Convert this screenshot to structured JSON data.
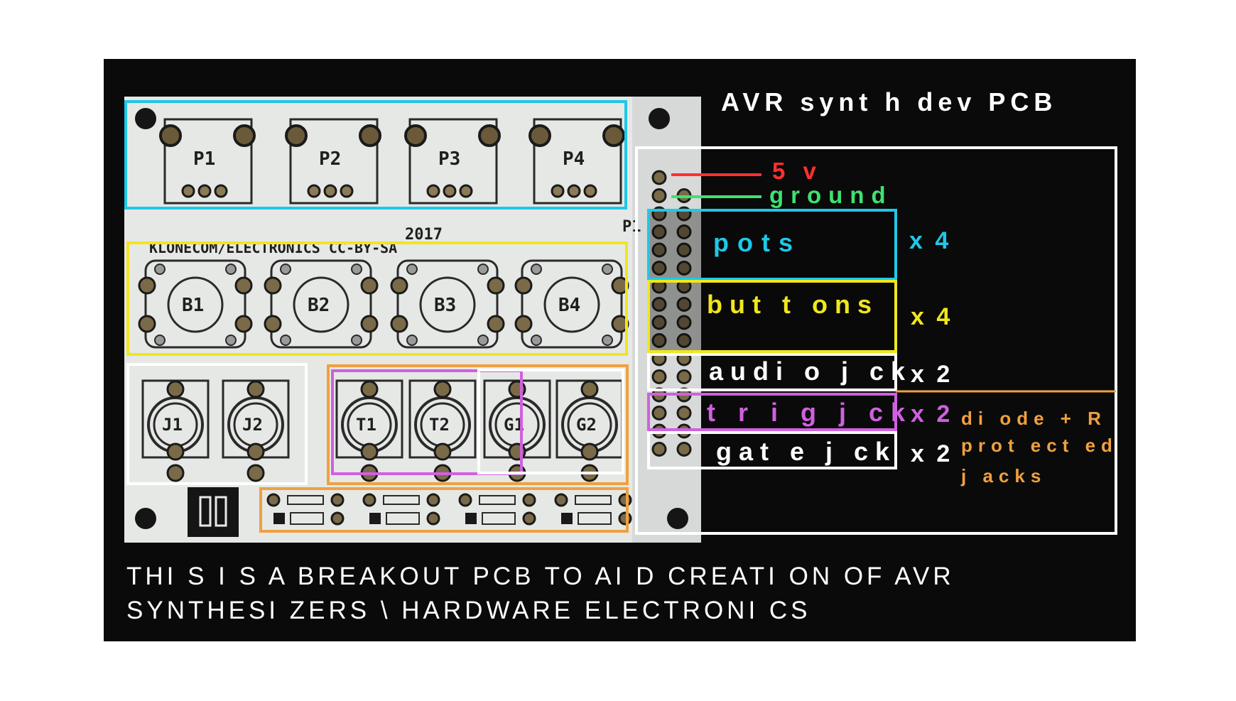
{
  "title": "AVR synt h dev PCB",
  "colors": {
    "background": "#0a0a0a",
    "board": "#e6e8e6",
    "pots": "#1ec8e8",
    "buttons": "#f0e61e",
    "audio": "#ffffff",
    "trig": "#d060e0",
    "gate": "#ffffff",
    "protected": "#f0a040",
    "vcc": "#ff3030",
    "ground": "#40e070"
  },
  "rail_labels": {
    "vcc": "5 v",
    "ground": "ground"
  },
  "sections": {
    "pots": {
      "label": "pots",
      "count": "x 4"
    },
    "buttons": {
      "label": "but t ons",
      "count": "x 4"
    },
    "audio": {
      "label": "audi o j ck",
      "count": "x 2"
    },
    "trig": {
      "label": "t r i g j ck",
      "count": "x 2"
    },
    "gate": {
      "label": "gat e j ck",
      "count": "x 2"
    }
  },
  "protected_note": [
    "di ode + R",
    "prot ect ed",
    "j acks"
  ],
  "board_silkscreen": {
    "pots": [
      "P1",
      "P2",
      "P3",
      "P4"
    ],
    "buttons": [
      "B1",
      "B2",
      "B3",
      "B4"
    ],
    "jacks": [
      "J1",
      "J2"
    ],
    "trig_gate": [
      "T1",
      "T2",
      "G1",
      "G2"
    ],
    "year": "2017",
    "credit": "KLONECOM/ELECTRONICS CC-BY-SA",
    "header": "P1"
  },
  "caption": [
    "THI S I S A BREAKOUT PCB TO AI D CREATI ON OF AVR",
    "SYNTHESI ZERS \\ HARDWARE ELECTRONI CS"
  ]
}
